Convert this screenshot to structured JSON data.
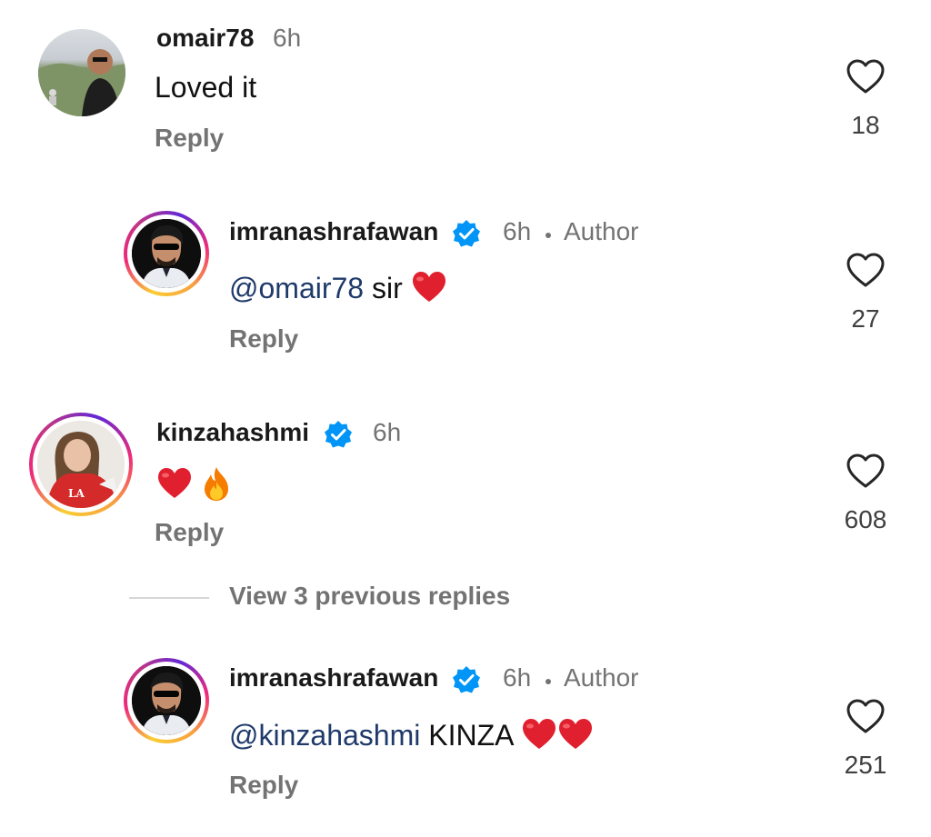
{
  "comments": [
    {
      "username": "omair78",
      "time": "6h",
      "text": "Loved it",
      "reply_label": "Reply",
      "likes": "18"
    },
    {
      "username": "imranashrafawan",
      "time": "6h",
      "author_label": "Author",
      "mention": "@omair78",
      "text": "sir",
      "reply_label": "Reply",
      "likes": "27"
    },
    {
      "username": "kinzahashmi",
      "time": "6h",
      "reply_label": "Reply",
      "likes": "608"
    },
    {
      "username": "imranashrafawan",
      "time": "6h",
      "author_label": "Author",
      "mention": "@kinzahashmi",
      "text": "KINZA",
      "reply_label": "Reply",
      "likes": "251"
    }
  ],
  "view_replies_label": "View 3 previous replies",
  "colors": {
    "muted": "#737373",
    "mention": "#1f3a6b",
    "verified": "#0095f6",
    "heart": "#e0202e"
  }
}
